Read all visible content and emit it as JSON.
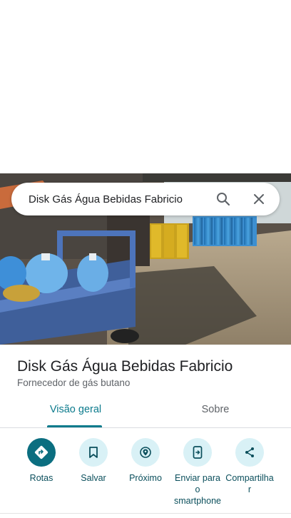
{
  "search": {
    "query": "Disk Gás Água Bebidas Fabricio"
  },
  "icons": {
    "search": "search-icon",
    "close": "close-icon",
    "directions": "directions-icon",
    "save": "bookmark-icon",
    "nearby": "nearby-icon",
    "send": "send-to-phone-icon",
    "share": "share-icon"
  },
  "place": {
    "name": "Disk Gás Água Bebidas Fabricio",
    "category": "Fornecedor de gás butano"
  },
  "tabs": {
    "overview": "Visão geral",
    "about": "Sobre"
  },
  "actions": {
    "directions": "Rotas",
    "save": "Salvar",
    "nearby": "Próximo",
    "send_line1": "Enviar para",
    "send_line2": "o",
    "send_line3": "smartphone",
    "share_line1": "Compartilha",
    "share_line2": "r"
  },
  "colors": {
    "accent": "#0b7a8c",
    "primary_button": "#0b6e80",
    "button_bg": "#d9f1f6"
  }
}
